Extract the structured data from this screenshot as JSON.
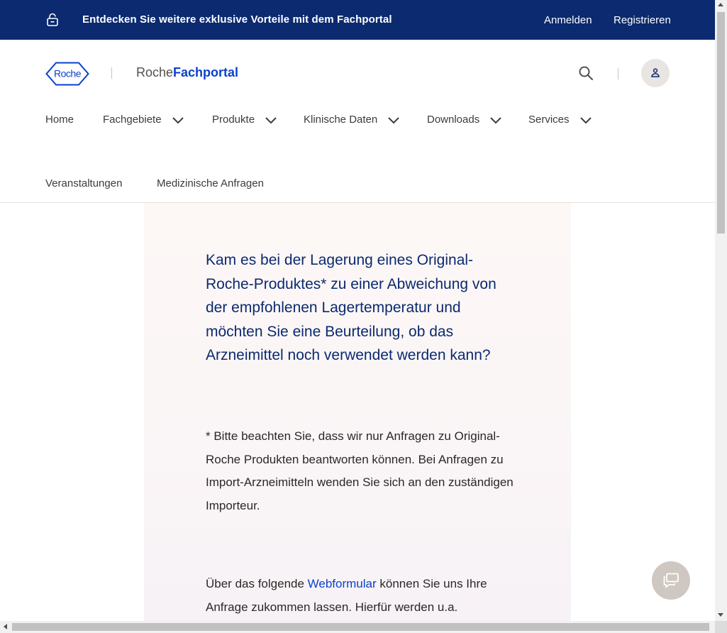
{
  "topbar": {
    "promo_text": "Entdecken Sie weitere exklusive Vorteile mit dem Fachportal",
    "login_label": "Anmelden",
    "register_label": "Registrieren",
    "icon": "unlock-icon",
    "background": "#0b2a6f"
  },
  "header": {
    "logo_text": "Roche",
    "portal_name_part1": "Roche",
    "portal_name_part2": "Fachportal",
    "search_icon": "search-icon",
    "user_icon": "user-icon",
    "brand_blue": "#0b41cd"
  },
  "nav": {
    "items": [
      {
        "label": "Home",
        "has_dropdown": false
      },
      {
        "label": "Fachgebiete",
        "has_dropdown": true
      },
      {
        "label": "Produkte",
        "has_dropdown": true
      },
      {
        "label": "Klinische Daten",
        "has_dropdown": true
      },
      {
        "label": "Downloads",
        "has_dropdown": true
      },
      {
        "label": "Services",
        "has_dropdown": true
      },
      {
        "label": "Veranstaltungen",
        "has_dropdown": false
      },
      {
        "label": "Medizinische Anfragen",
        "has_dropdown": false
      }
    ]
  },
  "main": {
    "question": "Kam es bei der Lagerung eines Original-Roche-Produktes* zu einer Abweichung von der empfohlenen Lagertemperatur und möchten Sie eine Beurteilung, ob das Arzneimittel noch verwendet werden kann?",
    "note": "* Bitte beachten Sie, dass wir nur Anfragen zu Original-Roche Produkten beantworten können. Bei Anfragen zu Import-Arzneimitteln wenden Sie sich an den zuständigen Importeur.",
    "form_text_before": "Über das folgende ",
    "form_link": "Webformular",
    "form_text_after": " können Sie uns Ihre Anfrage zukommen lassen. Hierfür werden u.a."
  },
  "chat": {
    "icon": "chat-icon"
  }
}
